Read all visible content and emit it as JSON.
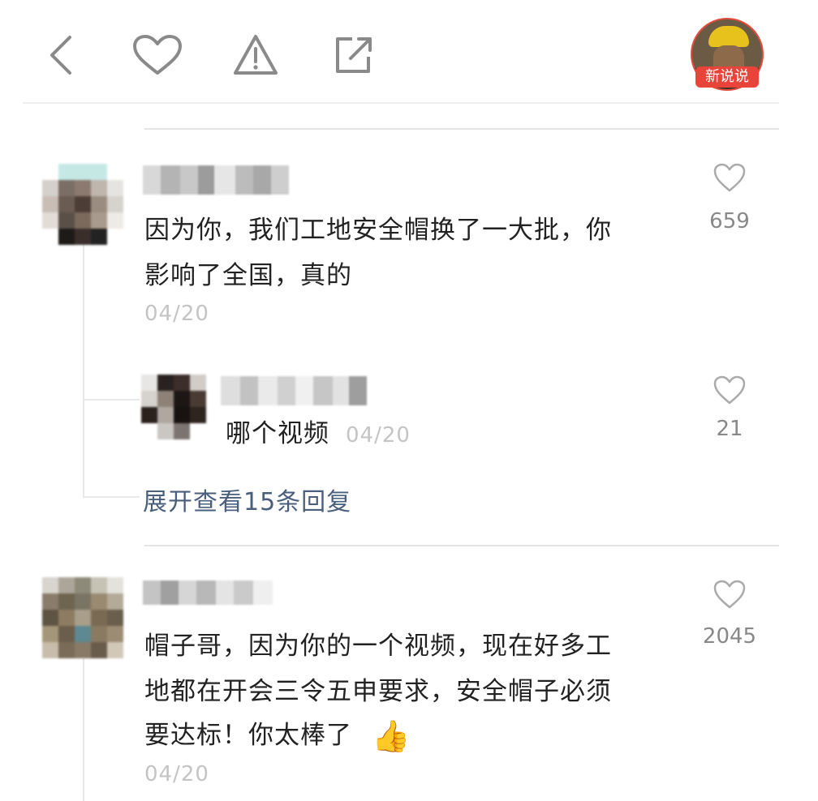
{
  "header": {
    "back_icon": "chevron-left-icon",
    "like_icon": "heart-icon",
    "report_icon": "warning-icon",
    "share_icon": "share-icon",
    "badge_label": "新说说"
  },
  "comments": [
    {
      "text_line1": "因为你，我们工地安全帽换了一大批，你",
      "text_line2": "影响了全国，真的",
      "date": "04/20",
      "likes": "659",
      "reply": {
        "text": "哪个视频",
        "date": "04/20",
        "likes": "21"
      },
      "expand_label": "展开查看15条回复"
    },
    {
      "text_line1": "帽子哥，因为你的一个视频，现在好多工",
      "text_line2": "地都在开会三令五申要求，安全帽子必须",
      "text_line3": "要达标！你太棒了",
      "emoji": "👍",
      "date": "04/20",
      "likes": "2045"
    }
  ],
  "colors": {
    "link": "#4a5f7c",
    "date": "#c4c4c4",
    "badge": "#e8443a"
  }
}
